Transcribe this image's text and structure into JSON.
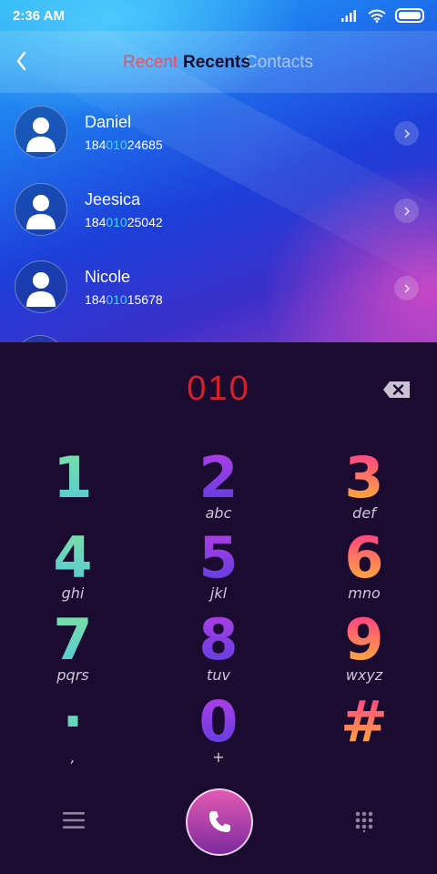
{
  "status": {
    "time": "2:36 AM"
  },
  "tabs": {
    "recent": "Recent",
    "recents": "Recents",
    "contacts": "Contacts"
  },
  "contacts": [
    {
      "name": "Daniel",
      "phone_prefix": "184",
      "phone_match": "010",
      "phone_suffix": "24685"
    },
    {
      "name": "Jeesica",
      "phone_prefix": "184",
      "phone_match": "010",
      "phone_suffix": "25042"
    },
    {
      "name": "Nicole",
      "phone_prefix": "184",
      "phone_match": "010",
      "phone_suffix": "15678"
    }
  ],
  "dialed_number": "010",
  "keypad": [
    {
      "digit": "1",
      "letters": ""
    },
    {
      "digit": "2",
      "letters": "abc"
    },
    {
      "digit": "3",
      "letters": "def"
    },
    {
      "digit": "4",
      "letters": "ghi"
    },
    {
      "digit": "5",
      "letters": "jkl"
    },
    {
      "digit": "6",
      "letters": "mno"
    },
    {
      "digit": "7",
      "letters": "pqrs"
    },
    {
      "digit": "8",
      "letters": "tuv"
    },
    {
      "digit": "9",
      "letters": "wxyz"
    },
    {
      "digit": "·",
      "letters": ","
    },
    {
      "digit": "0",
      "letters": "+"
    },
    {
      "digit": "#",
      "letters": ""
    }
  ],
  "icons": {
    "back": "chevron-left-icon",
    "backspace": "backspace-icon",
    "call": "phone-icon",
    "menu": "menu-icon",
    "keypad": "keypad-grid-icon"
  },
  "colors": {
    "dialed": "#d3212a",
    "match_highlight": "#49d2f5",
    "pad_background": "#1b0b30"
  }
}
